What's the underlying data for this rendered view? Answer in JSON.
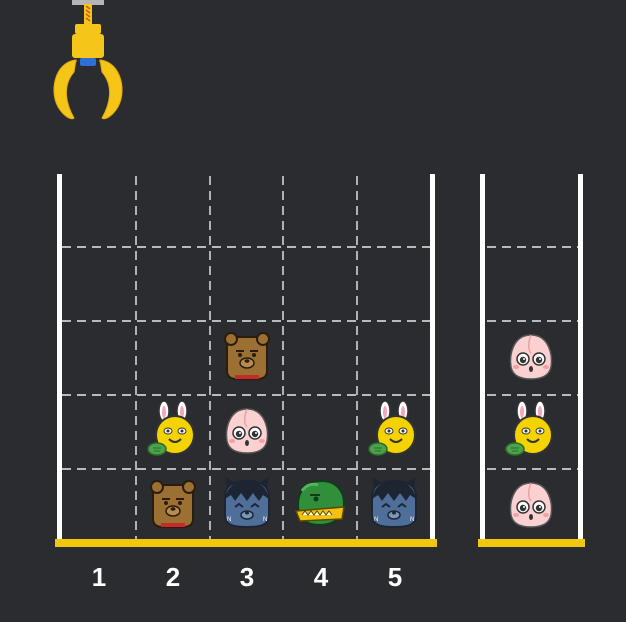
{
  "colors": {
    "background": "#2b2c2f",
    "wall": "#ffffff",
    "floor": "#f2c80f",
    "grid_line": "#ffffff",
    "claw": "#f5c518"
  },
  "board": {
    "columns": 5,
    "rows": 5,
    "column_labels": [
      "1",
      "2",
      "3",
      "4",
      "5"
    ],
    "pieces": [
      {
        "column": 2,
        "row_from_bottom": 1,
        "character": "ryan"
      },
      {
        "column": 2,
        "row_from_bottom": 2,
        "character": "muzi"
      },
      {
        "column": 3,
        "row_from_bottom": 1,
        "character": "neo"
      },
      {
        "column": 3,
        "row_from_bottom": 2,
        "character": "apeach"
      },
      {
        "column": 3,
        "row_from_bottom": 3,
        "character": "ryan"
      },
      {
        "column": 4,
        "row_from_bottom": 1,
        "character": "jay-g"
      },
      {
        "column": 5,
        "row_from_bottom": 1,
        "character": "neo"
      },
      {
        "column": 5,
        "row_from_bottom": 2,
        "character": "muzi"
      }
    ]
  },
  "basket": {
    "rows": 5,
    "pieces": [
      {
        "row_from_bottom": 1,
        "character": "apeach"
      },
      {
        "row_from_bottom": 2,
        "character": "muzi"
      },
      {
        "row_from_bottom": 3,
        "character": "apeach"
      }
    ]
  },
  "claw": {
    "icon": "crane-claw-icon",
    "position_column": "above-board-left"
  }
}
